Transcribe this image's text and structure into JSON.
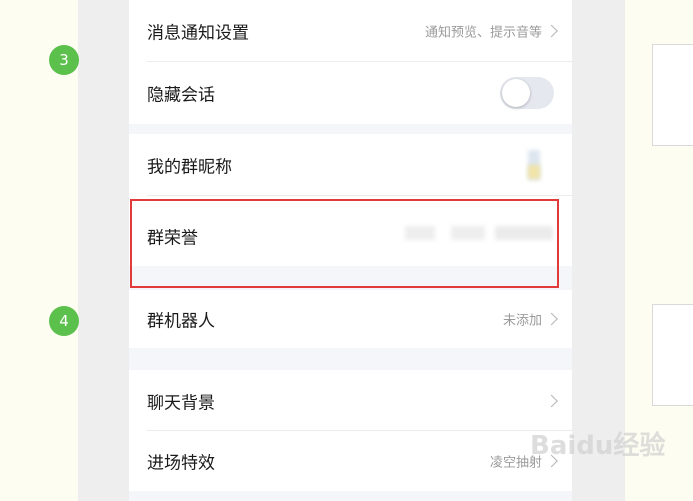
{
  "steps": {
    "first": "3",
    "second": "4"
  },
  "rows": {
    "notification": {
      "label": "消息通知设置",
      "value": "通知预览、提示音等"
    },
    "hide_chat": {
      "label": "隐藏会话",
      "toggle_on": false
    },
    "group_nickname": {
      "label": "我的群昵称"
    },
    "group_honor": {
      "label": "群荣誉"
    },
    "group_robot": {
      "label": "群机器人",
      "value": "未添加"
    },
    "chat_background": {
      "label": "聊天背景"
    },
    "entry_effect": {
      "label": "进场特效",
      "value": "凌空抽射"
    }
  },
  "watermark": "Baidu经验",
  "colors": {
    "accent_green": "#5cc14c",
    "highlight_red": "#e23a3a"
  },
  "icons": {
    "chevron": "chevron-right-icon",
    "toggle": "toggle-switch"
  }
}
